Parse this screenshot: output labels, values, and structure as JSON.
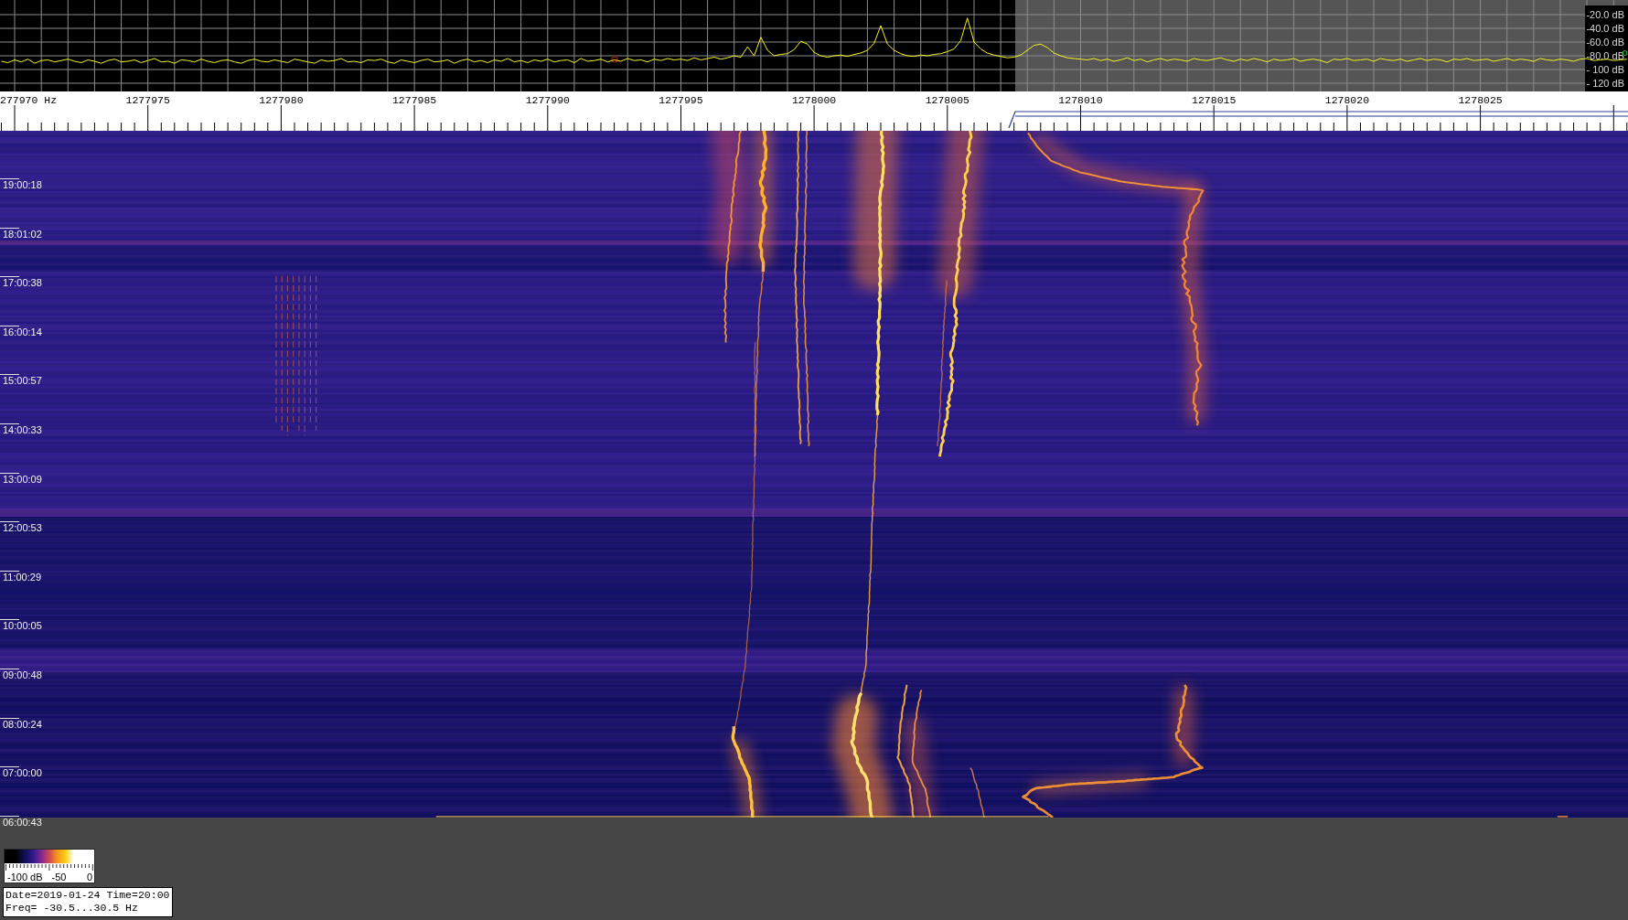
{
  "spectrum": {
    "chart_data": {
      "type": "line",
      "xlim": [
        1277969.45,
        1278030.54
      ],
      "ylim": [
        -132,
        1.33
      ],
      "grid": true,
      "xticks": [
        {
          "value": 1277975,
          "label": "1277975"
        },
        {
          "value": 1277980,
          "label": "1277980"
        },
        {
          "value": 1277985,
          "label": "1277985"
        },
        {
          "value": 1277990,
          "label": "1277990"
        },
        {
          "value": 1277995,
          "label": "1277995"
        },
        {
          "value": 1278000,
          "label": "1278000"
        },
        {
          "value": 1278005,
          "label": "1278005"
        },
        {
          "value": 1278010,
          "label": "1278010"
        },
        {
          "value": 1278015,
          "label": "1278015"
        },
        {
          "value": 1278020,
          "label": "1278020"
        },
        {
          "value": 1278025,
          "label": "1278025"
        }
      ],
      "yticks": [
        {
          "value": -20,
          "label": "-20.0 dB"
        },
        {
          "value": -40,
          "label": "-40.0 dB"
        },
        {
          "value": -60,
          "label": "-60.0 dB"
        },
        {
          "value": -80,
          "label": "-80.0 dB"
        },
        {
          "value": -100,
          "label": "- 100 dB"
        },
        {
          "value": -120,
          "label": "- 120 dB"
        }
      ],
      "x": [
        1277969.5,
        1277969.75,
        1277970,
        1277970.25,
        1277970.5,
        1277970.75,
        1277971,
        1277971.25,
        1277971.5,
        1277971.75,
        1277972,
        1277972.25,
        1277972.5,
        1277972.75,
        1277973,
        1277973.25,
        1277973.5,
        1277973.75,
        1277974,
        1277974.25,
        1277974.5,
        1277974.75,
        1277975,
        1277975.25,
        1277975.5,
        1277975.75,
        1277976,
        1277976.25,
        1277976.5,
        1277976.75,
        1277977,
        1277977.25,
        1277977.5,
        1277977.75,
        1277978,
        1277978.25,
        1277978.5,
        1277978.75,
        1277979,
        1277979.25,
        1277979.5,
        1277979.75,
        1277980,
        1277980.25,
        1277980.5,
        1277980.75,
        1277981,
        1277981.25,
        1277981.5,
        1277981.75,
        1277982,
        1277982.25,
        1277982.5,
        1277982.75,
        1277983,
        1277983.25,
        1277983.5,
        1277983.75,
        1277984,
        1277984.25,
        1277984.5,
        1277984.75,
        1277985,
        1277985.25,
        1277985.5,
        1277985.75,
        1277986,
        1277986.25,
        1277986.5,
        1277986.75,
        1277987,
        1277987.25,
        1277987.5,
        1277987.75,
        1277988,
        1277988.25,
        1277988.5,
        1277988.75,
        1277989,
        1277989.25,
        1277989.5,
        1277989.75,
        1277990,
        1277990.25,
        1277990.5,
        1277990.75,
        1277991,
        1277991.25,
        1277991.5,
        1277991.75,
        1277992,
        1277992.25,
        1277992.5,
        1277992.75,
        1277993,
        1277993.25,
        1277993.5,
        1277993.75,
        1277994,
        1277994.25,
        1277994.5,
        1277994.75,
        1277995,
        1277995.25,
        1277995.5,
        1277995.75,
        1277996,
        1277996.25,
        1277996.5,
        1277996.75,
        1277997,
        1277997.25,
        1277997.5,
        1277997.75,
        1277998,
        1277998.25,
        1277998.5,
        1277998.75,
        1277999,
        1277999.25,
        1277999.5,
        1277999.75,
        1278000,
        1278000.25,
        1278000.5,
        1278000.75,
        1278001,
        1278001.25,
        1278001.5,
        1278001.75,
        1278002,
        1278002.25,
        1278002.5,
        1278002.75,
        1278003,
        1278003.25,
        1278003.5,
        1278003.75,
        1278004,
        1278004.25,
        1278004.5,
        1278004.75,
        1278005,
        1278005.25,
        1278005.5,
        1278005.75,
        1278006,
        1278006.25,
        1278006.5,
        1278006.75,
        1278007,
        1278007.25,
        1278007.5,
        1278007.75,
        1278008,
        1278008.25,
        1278008.5,
        1278008.75,
        1278009,
        1278009.25,
        1278009.5,
        1278009.75,
        1278010,
        1278010.25,
        1278010.5,
        1278010.75,
        1278011,
        1278011.25,
        1278011.5,
        1278011.75,
        1278012,
        1278012.25,
        1278012.5,
        1278012.75,
        1278013,
        1278013.25,
        1278013.5,
        1278013.75,
        1278014,
        1278014.25,
        1278014.5,
        1278014.75,
        1278015,
        1278015.25,
        1278015.5,
        1278015.75,
        1278016,
        1278016.25,
        1278016.5,
        1278016.75,
        1278017,
        1278017.25,
        1278017.5,
        1278017.75,
        1278018,
        1278018.25,
        1278018.5,
        1278018.75,
        1278019,
        1278019.25,
        1278019.5,
        1278019.75,
        1278020,
        1278020.25,
        1278020.5,
        1278020.75,
        1278021,
        1278021.25,
        1278021.5,
        1278021.75,
        1278022,
        1278022.25,
        1278022.5,
        1278022.75,
        1278023,
        1278023.25,
        1278023.5,
        1278023.75,
        1278024,
        1278024.25,
        1278024.5,
        1278024.75,
        1278025,
        1278025.25,
        1278025.5,
        1278025.75,
        1278026,
        1278026.25,
        1278026.5,
        1278026.75,
        1278027,
        1278027.25,
        1278027.5,
        1278027.75,
        1278028,
        1278028.25,
        1278028.5,
        1278028.75,
        1278029,
        1278029.25,
        1278029.5,
        1278029.75,
        1278030,
        1278030.25,
        1278030.5
      ],
      "series": [
        {
          "color": "#f4f428",
          "values": [
            -88,
            -90,
            -86,
            -89,
            -85,
            -91,
            -87,
            -86,
            -89,
            -87,
            -85,
            -88,
            -90,
            -86,
            -88,
            -91,
            -87,
            -85,
            -89,
            -88,
            -86,
            -90,
            -87,
            -84,
            -89,
            -88,
            -91,
            -86,
            -87,
            -89,
            -85,
            -88,
            -90,
            -87,
            -86,
            -89,
            -91,
            -87,
            -85,
            -88,
            -89,
            -86,
            -88,
            -90,
            -85,
            -87,
            -89,
            -91,
            -86,
            -88,
            -87,
            -84,
            -89,
            -88,
            -90,
            -86,
            -87,
            -85,
            -89,
            -91,
            -86,
            -88,
            -90,
            -87,
            -85,
            -89,
            -88,
            -86,
            -91,
            -87,
            -85,
            -89,
            -87,
            -90,
            -86,
            -88,
            -84,
            -89,
            -87,
            -90,
            -86,
            -88,
            -85,
            -89,
            -87,
            -86,
            -90,
            -84,
            -88,
            -87,
            -85,
            -89,
            -86,
            -88,
            -84,
            -87,
            -86,
            -89,
            -85,
            -87,
            -84,
            -86,
            -85,
            -87,
            -83,
            -86,
            -84,
            -82,
            -85,
            -83,
            -80,
            -82,
            -67,
            -80,
            -53,
            -72,
            -80,
            -78,
            -77,
            -71,
            -59,
            -63,
            -75,
            -80,
            -82,
            -80,
            -79,
            -81,
            -78,
            -76,
            -72,
            -62,
            -36,
            -63,
            -72,
            -77,
            -80,
            -81,
            -79,
            -80,
            -78,
            -77,
            -74,
            -70,
            -58,
            -25,
            -60,
            -70,
            -76,
            -79,
            -81,
            -83,
            -82,
            -79,
            -72,
            -65,
            -63,
            -68,
            -76,
            -80,
            -83,
            -84,
            -85,
            -86,
            -84,
            -87,
            -85,
            -88,
            -86,
            -83,
            -87,
            -85,
            -89,
            -86,
            -84,
            -87,
            -85,
            -86,
            -88,
            -84,
            -86,
            -87,
            -85,
            -83,
            -86,
            -88,
            -85,
            -87,
            -84,
            -86,
            -89,
            -85,
            -87,
            -86,
            -84,
            -88,
            -86,
            -85,
            -87,
            -90,
            -85,
            -86,
            -84,
            -87,
            -86,
            -85,
            -88,
            -84,
            -86,
            -87,
            -85,
            -88,
            -86,
            -84,
            -87,
            -85,
            -86,
            -89,
            -85,
            -86,
            -84,
            -87,
            -86,
            -85,
            -88,
            -86,
            -84,
            -87,
            -85,
            -86,
            -88,
            -84,
            -86,
            -87,
            -85,
            -86,
            -88,
            -85,
            -84,
            -87,
            -86,
            -85,
            -87,
            -86,
            -85
          ]
        }
      ]
    }
  },
  "frequency_axis": {
    "start_label": "277970 Hz"
  },
  "waterfall": {
    "time_labels": [
      "19:00:18",
      "18:01:02",
      "17:00:38",
      "16:00:14",
      "15:00:57",
      "14:00:33",
      "13:00:09",
      "12:00:53",
      "11:00:29",
      "10:00:05",
      "09:00:48",
      "08:00:24",
      "07:00:00",
      "06:00:43"
    ]
  },
  "color_legend": {
    "labels": [
      "-100 dB",
      "-50",
      "0"
    ]
  },
  "info_box": {
    "lines": [
      "Date=2019-01-24 Time=20:00",
      "Freq= -30.5...30.5 Hz"
    ]
  }
}
